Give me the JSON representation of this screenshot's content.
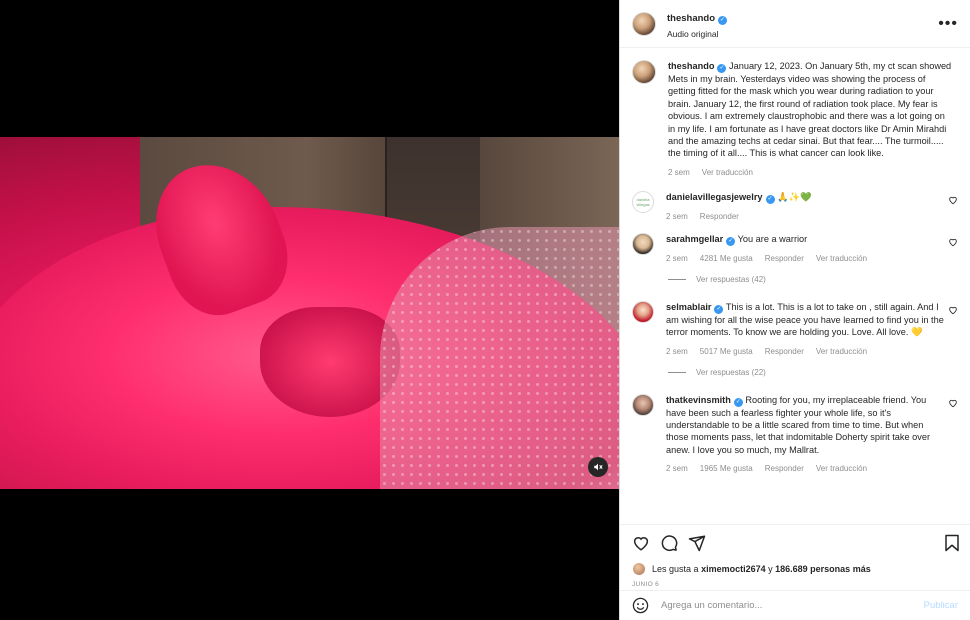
{
  "post": {
    "username": "theshando",
    "audio": "Audio original"
  },
  "caption": {
    "username": "theshando",
    "text": "January 12, 2023. On January 5th, my ct scan showed Mets in my brain. Yesterdays video was showing the process of getting fitted for the mask which you wear during radiation to your brain. January 12, the first round of radiation took place. My fear is obvious. I am extremely claustrophobic and there was a lot going on in my life. I am fortunate as I have great doctors like Dr Amin Mirahdi and the amazing techs at cedar sinai. But that fear.... The turmoil..... the timing of it all.... This is what cancer can look like.",
    "time": "2 sem",
    "translate": "Ver traducción"
  },
  "comments": [
    {
      "username": "danielavillegasjewelry",
      "avatar_text": "daniela villegas",
      "text": "🙏✨💚",
      "time": "2 sem",
      "likes": "",
      "reply": "Responder",
      "translate": "",
      "replies": ""
    },
    {
      "username": "sarahmgellar",
      "text": "You are a warrior",
      "time": "2 sem",
      "likes": "4281 Me gusta",
      "reply": "Responder",
      "translate": "Ver traducción",
      "replies": "Ver respuestas (42)"
    },
    {
      "username": "selmablair",
      "text": "This is a lot. This is a lot to take on , still again. And I am wishing for all the wise peace you have learned to find you in the terror moments. To know we are holding you. Love. All love. 💛",
      "time": "2 sem",
      "likes": "5017 Me gusta",
      "reply": "Responder",
      "translate": "Ver traducción",
      "replies": "Ver respuestas (22)"
    },
    {
      "username": "thatkevinsmith",
      "text": "Rooting for you, my irreplaceable friend. You have been such a fearless fighter your whole life, so it's understandable to be a little scared from time to time. But when those moments pass, let that indomitable Doherty spirit take over anew. I love you so much, my Mallrat.",
      "time": "2 sem",
      "likes": "1965 Me gusta",
      "reply": "Responder",
      "translate": "Ver traducción",
      "replies": ""
    }
  ],
  "likes_line": {
    "prefix": "Les gusta a",
    "user": "ximemocti2674",
    "middle": "y",
    "count": "186.689 personas más"
  },
  "date": "JUNIO 6",
  "composer": {
    "placeholder": "Agrega un comentario...",
    "publish": "Publicar"
  },
  "icons": [
    "more-icon",
    "heart-icon",
    "comment-icon",
    "share-icon",
    "save-icon",
    "emoji-icon",
    "mute-icon",
    "verified-icon"
  ],
  "colors": {
    "verified": "#3897f0",
    "publish": "#b3dbff",
    "muted_text": "#8e8e8e"
  }
}
